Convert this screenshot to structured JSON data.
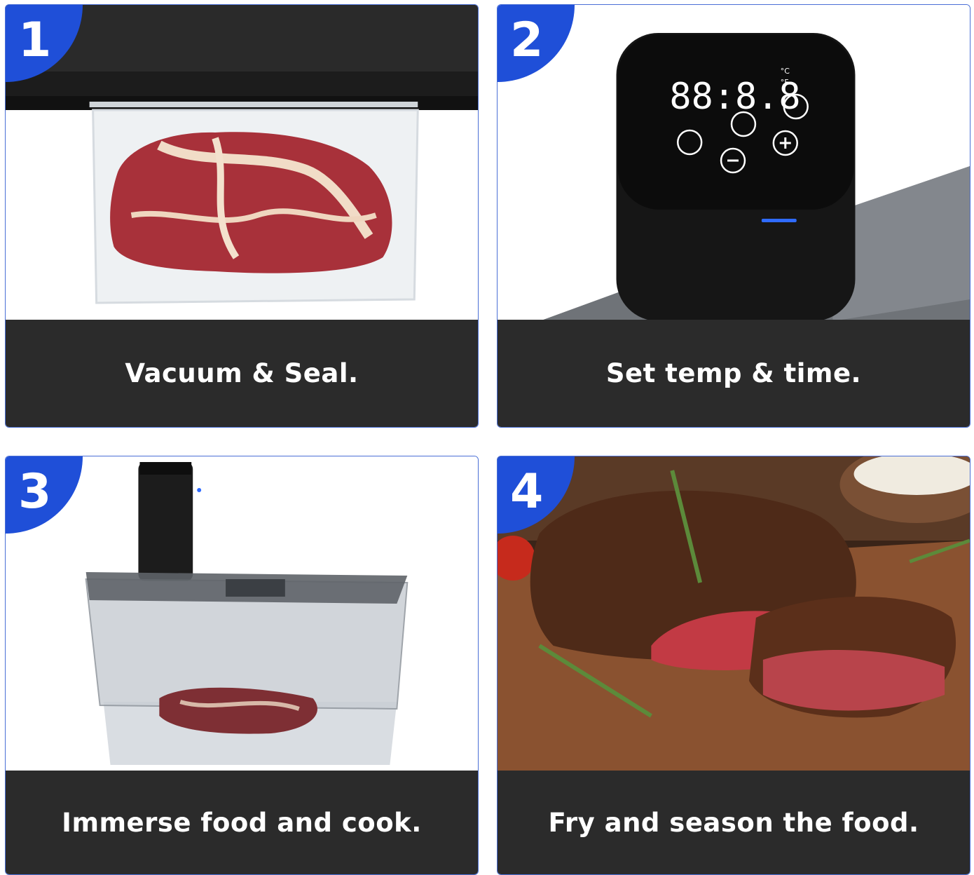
{
  "steps": [
    {
      "number": "1",
      "caption": "Vacuum & Seal."
    },
    {
      "number": "2",
      "caption": "Set temp & time."
    },
    {
      "number": "3",
      "caption": "Immerse food and cook."
    },
    {
      "number": "4",
      "caption": "Fry and season the food."
    }
  ],
  "device_display": {
    "readout": "88:8.8",
    "unit_c": "°C",
    "unit_f": "°F"
  },
  "colors": {
    "badge": "#1f4fd8",
    "caption_bar": "#2b2b2b",
    "border": "#4a6fd6"
  }
}
